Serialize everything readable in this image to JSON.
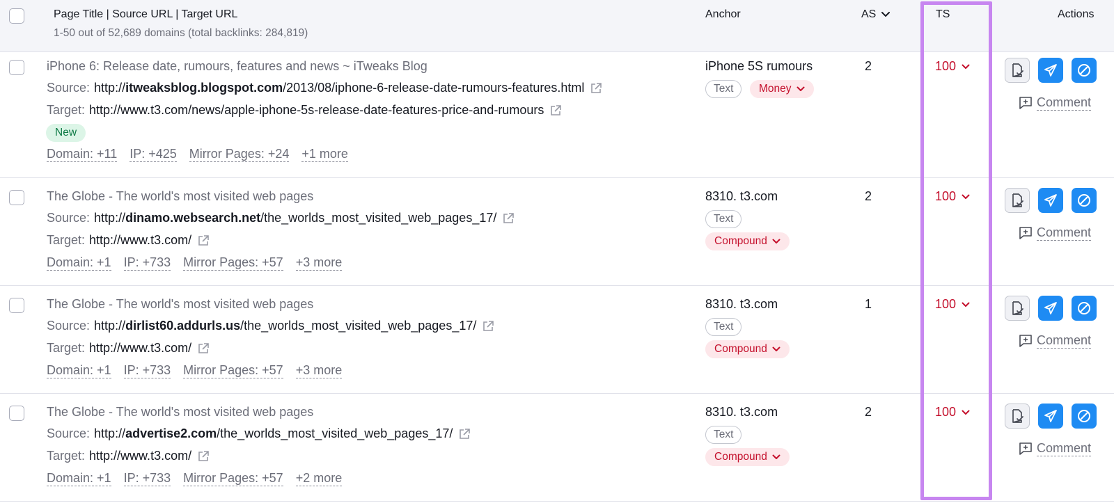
{
  "header": {
    "col_page": "Page Title | Source URL | Target URL",
    "summary": "1-50 out of 52,689 domains (total backlinks: 284,819)",
    "col_anchor": "Anchor",
    "col_as": "AS",
    "col_ts": "TS",
    "col_actions": "Actions"
  },
  "labels": {
    "source": "Source:",
    "target": "Target:",
    "comment": "Comment"
  },
  "rows": [
    {
      "title": "iPhone 6: Release date, rumours, features and news ~ iTweaks Blog",
      "source_prefix": "http://",
      "source_domain": "itweaksblog.blogspot.com",
      "source_path": "/2013/08/iphone-6-release-date-rumours-features.html",
      "target": "http://www.t3.com/news/apple-iphone-5s-release-date-features-price-and-rumours",
      "badge": "New",
      "metrics": [
        "Domain: +11",
        "IP: +425",
        "Mirror Pages: +24",
        "+1 more"
      ],
      "anchor": "iPhone 5S rumours",
      "tag_type": "Text",
      "tag_category": "Money",
      "as": "2",
      "ts": "100"
    },
    {
      "title": "The Globe - The world's most visited web pages",
      "source_prefix": "http://",
      "source_domain": "dinamo.websearch.net",
      "source_path": "/the_worlds_most_visited_web_pages_17/",
      "target": "http://www.t3.com/",
      "metrics": [
        "Domain: +1",
        "IP: +733",
        "Mirror Pages: +57",
        "+3 more"
      ],
      "anchor": "8310. t3.com",
      "tag_type": "Text",
      "tag_category": "Compound",
      "as": "2",
      "ts": "100"
    },
    {
      "title": "The Globe - The world's most visited web pages",
      "source_prefix": "http://",
      "source_domain": "dirlist60.addurls.us",
      "source_path": "/the_worlds_most_visited_web_pages_17/",
      "target": "http://www.t3.com/",
      "metrics": [
        "Domain: +1",
        "IP: +733",
        "Mirror Pages: +57",
        "+3 more"
      ],
      "anchor": "8310. t3.com",
      "tag_type": "Text",
      "tag_category": "Compound",
      "as": "1",
      "ts": "100"
    },
    {
      "title": "The Globe - The world's most visited web pages",
      "source_prefix": "http://",
      "source_domain": "advertise2.com",
      "source_path": "/the_worlds_most_visited_web_pages_17/",
      "target": "http://www.t3.com/",
      "metrics": [
        "Domain: +1",
        "IP: +733",
        "Mirror Pages: +57",
        "+2 more"
      ],
      "anchor": "8310. t3.com",
      "tag_type": "Text",
      "tag_category": "Compound",
      "as": "2",
      "ts": "100"
    }
  ],
  "colors": {
    "accent_blue": "#1e8bf3",
    "ts_red": "#c4102c",
    "highlight_purple": "#c786f0",
    "new_badge_green": "#dcf5e7"
  },
  "icons": [
    "checkbox",
    "chevron-down-icon",
    "external-link-icon",
    "review-doc-icon",
    "send-icon",
    "block-icon",
    "comment-plus-icon"
  ]
}
